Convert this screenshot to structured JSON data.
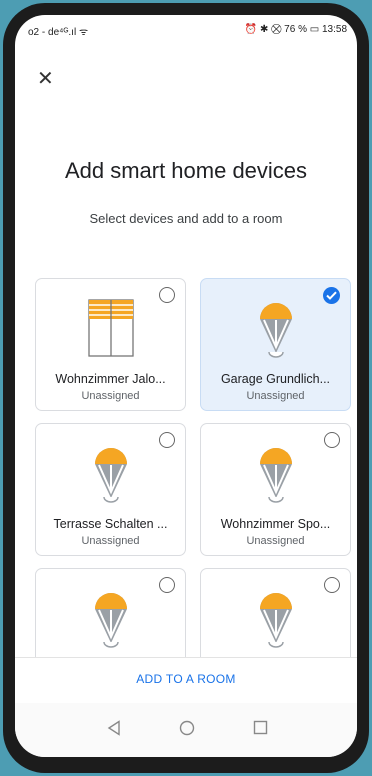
{
  "status_bar": {
    "left": "o2 - de⁴ᴳ.ıl ᯤ",
    "right": "⏰ ✱ ⛒ 76 % ▭ 13:58"
  },
  "header": {
    "title": "Add smart home devices",
    "subtitle": "Select devices and add to a room"
  },
  "devices": [
    {
      "name": "Wohnzimmer Jalo...",
      "room": "Unassigned",
      "icon": "blinds-icon",
      "selected": false
    },
    {
      "name": "Garage Grundlich...",
      "room": "Unassigned",
      "icon": "light-bulb-icon",
      "selected": true
    },
    {
      "name": "Terrasse Schalten ...",
      "room": "Unassigned",
      "icon": "light-bulb-icon",
      "selected": false
    },
    {
      "name": "Wohnzimmer Spo...",
      "room": "Unassigned",
      "icon": "light-bulb-icon",
      "selected": false
    },
    {
      "name": "",
      "room": "",
      "icon": "light-bulb-icon",
      "selected": false
    },
    {
      "name": "",
      "room": "",
      "icon": "light-bulb-icon",
      "selected": false
    }
  ],
  "footer": {
    "add_label": "ADD TO A ROOM"
  },
  "nav_bar": {
    "items": [
      "back-icon",
      "home-icon",
      "recents-icon"
    ]
  },
  "colors": {
    "accent": "#1a73e8",
    "bulb_yellow": "#f5a623",
    "selected_bg": "#e7f0fb",
    "backdrop": "#4d9db3"
  }
}
